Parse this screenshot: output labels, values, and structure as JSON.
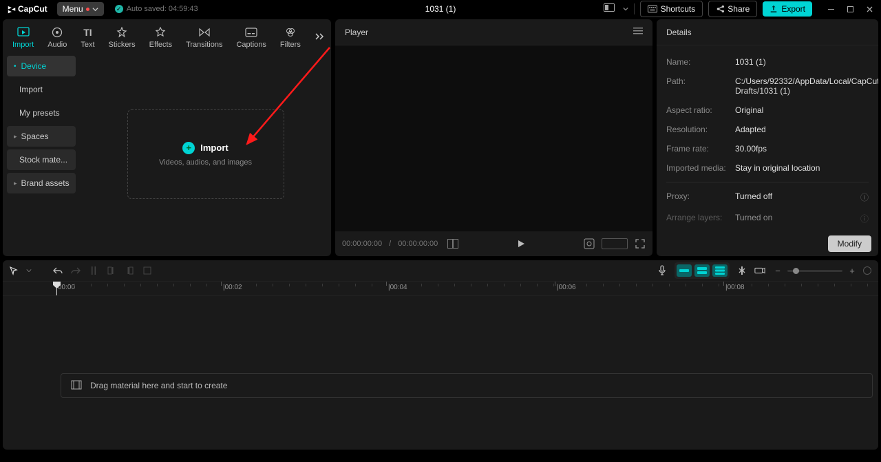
{
  "app": {
    "name": "CapCut"
  },
  "menu": {
    "label": "Menu"
  },
  "autosave": {
    "text": "Auto saved: 04:59:43"
  },
  "project_title": "1031 (1)",
  "header_buttons": {
    "shortcuts": "Shortcuts",
    "share": "Share",
    "export": "Export"
  },
  "tabs": [
    {
      "label": "Import"
    },
    {
      "label": "Audio"
    },
    {
      "label": "Text"
    },
    {
      "label": "Stickers"
    },
    {
      "label": "Effects"
    },
    {
      "label": "Transitions"
    },
    {
      "label": "Captions"
    },
    {
      "label": "Filters"
    }
  ],
  "sidebar": {
    "items": [
      {
        "label": "Device",
        "active": true,
        "bullet": true
      },
      {
        "label": "Import"
      },
      {
        "label": "My presets"
      },
      {
        "label": "Spaces",
        "expand": true
      },
      {
        "label": "Stock mate..."
      },
      {
        "label": "Brand assets",
        "expand": true
      }
    ]
  },
  "import_box": {
    "title": "Import",
    "subtitle": "Videos, audios, and images"
  },
  "player": {
    "title": "Player",
    "time_current": "00:00:00:00",
    "time_sep": " / ",
    "time_total": "00:00:00:00"
  },
  "details": {
    "title": "Details",
    "rows": {
      "name_l": "Name:",
      "name_v": "1031 (1)",
      "path_l": "Path:",
      "path_v": "C:/Users/92332/AppData/Local/CapCut Drafts/1031 (1)",
      "aspect_l": "Aspect ratio:",
      "aspect_v": "Original",
      "res_l": "Resolution:",
      "res_v": "Adapted",
      "fr_l": "Frame rate:",
      "fr_v": "30.00fps",
      "im_l": "Imported media:",
      "im_v": "Stay in original location",
      "proxy_l": "Proxy:",
      "proxy_v": "Turned off",
      "arrange_l": "Arrange layers:",
      "arrange_v": "Turned on"
    },
    "modify": "Modify"
  },
  "timeline": {
    "ticks": [
      "00:00",
      "|00:02",
      "|00:04",
      "|00:06",
      "|00:08"
    ],
    "empty_hint": "Drag material here and start to create"
  }
}
